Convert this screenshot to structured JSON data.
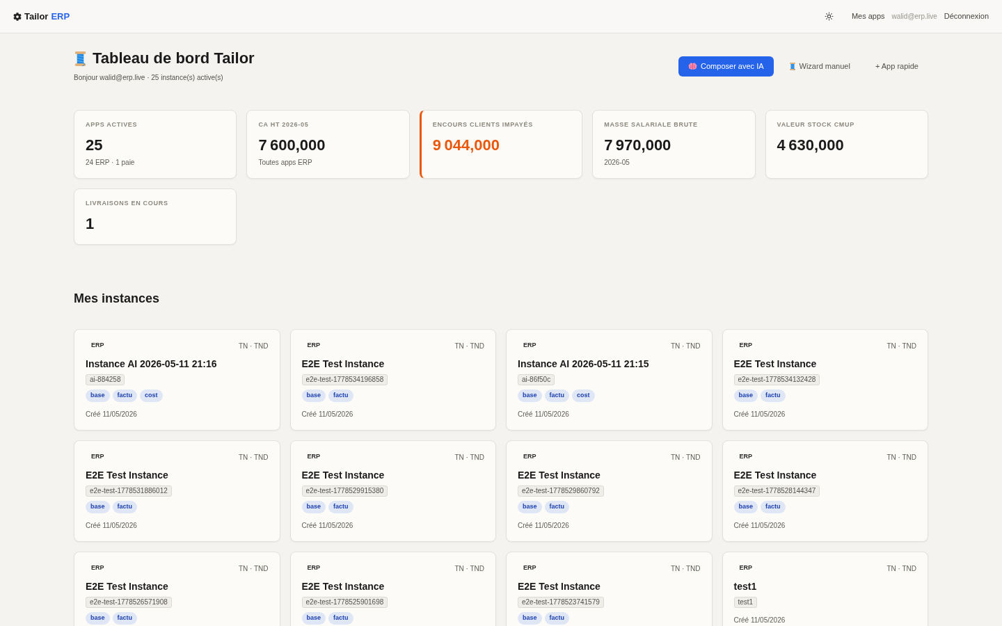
{
  "top_bar": {
    "brand_name": "Tailor",
    "brand_accent": "ERP",
    "nav_link": "Mes apps",
    "user_email": "walid@erp.live",
    "logout": "Déconnexion"
  },
  "dashboard": {
    "title": "Tableau de bord Tailor",
    "greeting": "Bonjour walid@erp.live · 25 instance(s) active(s)",
    "actions": [
      {
        "kind": "ai",
        "label": "Composer avec IA"
      },
      {
        "kind": "wizard",
        "label": "Wizard manuel"
      },
      {
        "kind": "quick",
        "label": "+ App rapide"
      }
    ]
  },
  "stats": [
    {
      "label": "APPS ACTIVES",
      "value": "25",
      "note": "24 ERP · 1 paie",
      "alert": false
    },
    {
      "label": "CA HT 2026-05",
      "value": "7 600,000",
      "note": "Toutes apps ERP",
      "alert": false
    },
    {
      "label": "ENCOURS CLIENTS IMPAYÉS",
      "value": "9 044,000",
      "alert": true
    },
    {
      "label": "MASSE SALARIALE BRUTE",
      "value": "7 970,000",
      "note": "2026-05",
      "alert": false
    },
    {
      "label": "VALEUR STOCK CMUP",
      "value": "4 630,000",
      "alert": false
    },
    {
      "label": "LIVRAISONS EN COURS",
      "value": "1",
      "alert": false
    }
  ],
  "instances": {
    "title": "Mes instances",
    "items": [
      {
        "type": "ERP",
        "locale": "TN · TND",
        "name": "Instance AI 2026-05-11 21:16",
        "slug": "ai-884258",
        "modules": [
          "base",
          "factu",
          "cost"
        ],
        "created": "Créé 11/05/2026"
      },
      {
        "type": "ERP",
        "locale": "TN · TND",
        "name": "E2E Test Instance",
        "slug": "e2e-test-1778534196858",
        "modules": [
          "base",
          "factu"
        ],
        "created": "Créé 11/05/2026"
      },
      {
        "type": "ERP",
        "locale": "TN · TND",
        "name": "Instance AI 2026-05-11 21:15",
        "slug": "ai-86f50c",
        "modules": [
          "base",
          "factu",
          "cost"
        ],
        "created": "Créé 11/05/2026"
      },
      {
        "type": "ERP",
        "locale": "TN · TND",
        "name": "E2E Test Instance",
        "slug": "e2e-test-1778534132428",
        "modules": [
          "base",
          "factu"
        ],
        "created": "Créé 11/05/2026"
      },
      {
        "type": "ERP",
        "locale": "TN · TND",
        "name": "E2E Test Instance",
        "slug": "e2e-test-1778531886012",
        "modules": [
          "base",
          "factu"
        ],
        "created": "Créé 11/05/2026"
      },
      {
        "type": "ERP",
        "locale": "TN · TND",
        "name": "E2E Test Instance",
        "slug": "e2e-test-1778529915380",
        "modules": [
          "base",
          "factu"
        ],
        "created": "Créé 11/05/2026"
      },
      {
        "type": "ERP",
        "locale": "TN · TND",
        "name": "E2E Test Instance",
        "slug": "e2e-test-1778529860792",
        "modules": [
          "base",
          "factu"
        ],
        "created": "Créé 11/05/2026"
      },
      {
        "type": "ERP",
        "locale": "TN · TND",
        "name": "E2E Test Instance",
        "slug": "e2e-test-1778528144347",
        "modules": [
          "base",
          "factu"
        ],
        "created": "Créé 11/05/2026"
      },
      {
        "type": "ERP",
        "locale": "TN · TND",
        "name": "E2E Test Instance",
        "slug": "e2e-test-1778526571908",
        "modules": [
          "base",
          "factu"
        ]
      },
      {
        "type": "ERP",
        "locale": "TN · TND",
        "name": "E2E Test Instance",
        "slug": "e2e-test-1778525901698",
        "modules": [
          "base",
          "factu"
        ]
      },
      {
        "type": "ERP",
        "locale": "TN · TND",
        "name": "E2E Test Instance",
        "slug": "e2e-test-1778523741579",
        "modules": [
          "base",
          "factu"
        ]
      },
      {
        "type": "ERP",
        "locale": "TN · TND",
        "name": "test1",
        "slug": "test1",
        "created": "Créé 11/05/2026"
      }
    ]
  }
}
